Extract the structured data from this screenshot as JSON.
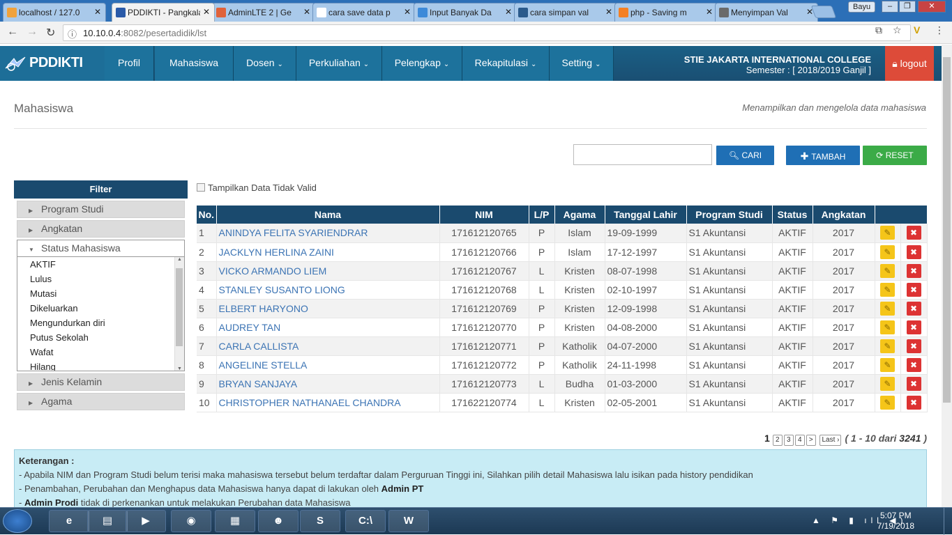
{
  "browser": {
    "tabs": [
      {
        "title": "localhost / 127.0",
        "icon": "phpmyadmin-icon",
        "color": "#f0a23c"
      },
      {
        "title": "PDDIKTI - Pangkalan",
        "icon": "pddikti-icon",
        "color": "#2a5aa8",
        "active": true
      },
      {
        "title": "AdminLTE 2 | Ge",
        "icon": "adminlte-icon",
        "color": "#e0623a"
      },
      {
        "title": "cara save data p",
        "icon": "google-icon",
        "color": "#ffffff"
      },
      {
        "title": "Input Banyak Da",
        "icon": "link-icon",
        "color": "#3d8ad9"
      },
      {
        "title": "cara simpan val",
        "icon": "stackexchange-icon",
        "color": "#2a5a8c"
      },
      {
        "title": "php - Saving m",
        "icon": "stackoverflow-icon",
        "color": "#f48024"
      },
      {
        "title": "Menyimpan Val",
        "icon": "site-icon",
        "color": "#6a6a6a"
      }
    ],
    "user": "Bayu",
    "url_host": "10.10.0.4",
    "url_path": ":8082/pesertadidik/lst"
  },
  "nav": {
    "brand": "PDDIKTI",
    "items": [
      {
        "label": "Profil",
        "dropdown": false
      },
      {
        "label": "Mahasiswa",
        "dropdown": false
      },
      {
        "label": "Dosen",
        "dropdown": true
      },
      {
        "label": "Perkuliahan",
        "dropdown": true
      },
      {
        "label": "Pelengkap",
        "dropdown": true
      },
      {
        "label": "Rekapitulasi",
        "dropdown": true
      },
      {
        "label": "Setting",
        "dropdown": true
      }
    ],
    "institution": "STIE JAKARTA INTERNATIONAL COLLEGE",
    "semester": "Semester : [ 2018/2019 Ganjil ]",
    "logout": "logout"
  },
  "page": {
    "title": "Mahasiswa",
    "description": "Menampilkan dan mengelola data mahasiswa",
    "search_value": "",
    "cari": "CARI",
    "tambah": "TAMBAH",
    "reset": "RESET",
    "show_invalid": "Tampilkan Data Tidak Valid"
  },
  "filter": {
    "title": "Filter",
    "groups_before": [
      "Program Studi",
      "Angkatan"
    ],
    "open_group": "Status Mahasiswa",
    "status_items": [
      "AKTIF",
      "Lulus",
      "Mutasi",
      "Dikeluarkan",
      "Mengundurkan diri",
      "Putus Sekolah",
      "Wafat",
      "Hilang"
    ],
    "groups_after": [
      "Jenis Kelamin",
      "Agama"
    ]
  },
  "table": {
    "headers": [
      "No.",
      "Nama",
      "NIM",
      "L/P",
      "Agama",
      "Tanggal Lahir",
      "Program Studi",
      "Status",
      "Angkatan"
    ],
    "rows": [
      [
        "1",
        "ANINDYA FELITA SYARIENDRAR",
        "171612120765",
        "P",
        "Islam",
        "19-09-1999",
        "S1 Akuntansi",
        "AKTIF",
        "2017"
      ],
      [
        "2",
        "JACKLYN HERLINA ZAINI",
        "171612120766",
        "P",
        "Islam",
        "17-12-1997",
        "S1 Akuntansi",
        "AKTIF",
        "2017"
      ],
      [
        "3",
        "VICKO ARMANDO LIEM",
        "171612120767",
        "L",
        "Kristen",
        "08-07-1998",
        "S1 Akuntansi",
        "AKTIF",
        "2017"
      ],
      [
        "4",
        "STANLEY SUSANTO LIONG",
        "171612120768",
        "L",
        "Kristen",
        "02-10-1997",
        "S1 Akuntansi",
        "AKTIF",
        "2017"
      ],
      [
        "5",
        "ELBERT HARYONO",
        "171612120769",
        "P",
        "Kristen",
        "12-09-1998",
        "S1 Akuntansi",
        "AKTIF",
        "2017"
      ],
      [
        "6",
        "AUDREY TAN",
        "171612120770",
        "P",
        "Kristen",
        "04-08-2000",
        "S1 Akuntansi",
        "AKTIF",
        "2017"
      ],
      [
        "7",
        "CARLA CALLISTA",
        "171612120771",
        "P",
        "Katholik",
        "04-07-2000",
        "S1 Akuntansi",
        "AKTIF",
        "2017"
      ],
      [
        "8",
        "ANGELINE STELLA",
        "171612120772",
        "P",
        "Katholik",
        "24-11-1998",
        "S1 Akuntansi",
        "AKTIF",
        "2017"
      ],
      [
        "9",
        "BRYAN SANJAYA",
        "171612120773",
        "L",
        "Budha",
        "01-03-2000",
        "S1 Akuntansi",
        "AKTIF",
        "2017"
      ],
      [
        "10",
        "CHRISTOPHER NATHANAEL CHANDRA",
        "171622120774",
        "L",
        "Kristen",
        "02-05-2001",
        "S1 Akuntansi",
        "AKTIF",
        "2017"
      ]
    ]
  },
  "pager": {
    "current": "1",
    "pages": [
      "2",
      "3",
      "4"
    ],
    "next": ">",
    "last": "Last",
    "info_range": "( 1 - 10 dari ",
    "info_total": "3241",
    "info_end": " )"
  },
  "note": {
    "title": "Keterangan :",
    "line1": "- Apabila NIM dan Program Studi belum terisi maka mahasiswa tersebut belum terdaftar dalam Perguruan Tinggi ini, Silahkan pilih detail Mahasiswa lalu isikan pada history pendidikan",
    "line2_a": "- Penambahan, Perubahan dan Menghapus data Mahasiswa hanya dapat di lakukan oleh ",
    "line2_b": "Admin PT",
    "line3_a": "- ",
    "line3_b": "Admin Prodi",
    "line3_c": " tidak di perkenankan untuk melakukan Perubahan data Mahasiswa"
  },
  "taskbar": {
    "time": "5:07 PM",
    "date": "7/19/2018",
    "apps": [
      "internet-explorer-icon",
      "file-explorer-icon",
      "media-player-icon",
      "chrome-icon",
      "sticky-notes-icon",
      "github-icon",
      "sublime-text-icon",
      "command-prompt-icon",
      "word-icon"
    ]
  },
  "colors": {
    "navbar": "#1a4f73",
    "accent": "#1a4a6e",
    "cari": "#1f6fb5",
    "tambah": "#1f6fb5",
    "reset": "#3bab47",
    "logout": "#dd4b39",
    "edit": "#f5c519",
    "delete": "#dd3333",
    "note": "#c8ecf5"
  }
}
